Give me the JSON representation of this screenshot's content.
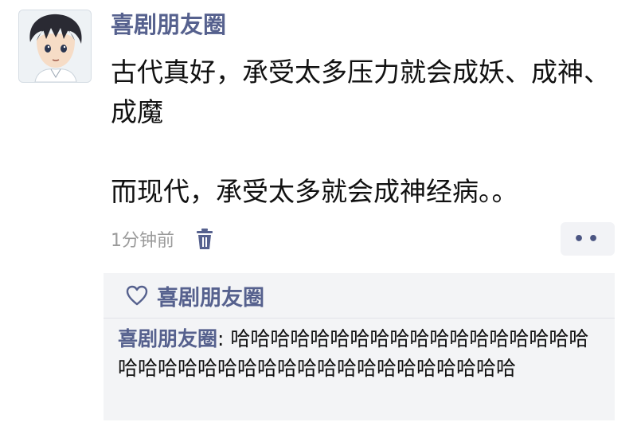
{
  "post": {
    "username": "喜剧朋友圈",
    "text_line1": "古代真好，承受太多压力就会成妖、成神、成魔",
    "text_line2": "而现代，承受太多就会成神经病。。",
    "time": "1分钟前",
    "more_label": "••"
  },
  "icons": {
    "avatar": "anime-boy-avatar",
    "delete": "trash-icon",
    "like": "heart-icon"
  },
  "likes": {
    "names": "喜剧朋友圈"
  },
  "comments": [
    {
      "author": "喜剧朋友圈",
      "separator": ": ",
      "text": "哈哈哈哈哈哈哈哈哈哈哈哈哈哈哈哈哈哈哈哈哈哈哈哈哈哈哈哈哈哈哈哈哈哈哈哈哈哈"
    }
  ],
  "colors": {
    "accent": "#56618e",
    "meta_text": "#9b9b9b",
    "comment_bg": "#f3f4f6"
  }
}
